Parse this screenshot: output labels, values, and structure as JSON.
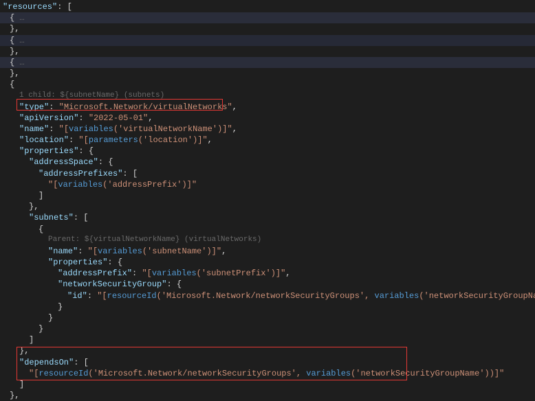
{
  "code": {
    "resourcesKey": "\"resources\"",
    "colon": ": ",
    "openBracket": "[",
    "closeBracket": "]",
    "openBrace": "{",
    "closeBrace": "}",
    "ellipsis": "…",
    "comma": ",",
    "hint1": "1 child: ${subnetName} (subnets)",
    "typeKey": "\"type\"",
    "typeValue": "\"Microsoft.Network/virtualNetworks\"",
    "apiVersionKey": "\"apiVersion\"",
    "apiVersionValue": "\"2022-05-01\"",
    "nameKey": "\"name\"",
    "nameValue1": "\"[",
    "nameFunc": "variables",
    "nameArg": "'virtualNetworkName'",
    "nameValue2": ")]\"",
    "locationKey": "\"location\"",
    "locationValue1": "\"[",
    "locationFunc": "parameters",
    "locationArg": "'location'",
    "locationValue2": ")]\"",
    "propertiesKey": "\"properties\"",
    "addressSpaceKey": "\"addressSpace\"",
    "addressPrefixesKey": "\"addressPrefixes\"",
    "addressPrefixValue1": "\"[",
    "addressPrefixFunc": "variables",
    "addressPrefixArg": "'addressPrefix'",
    "addressPrefixValue2": ")]\"",
    "subnetsKey": "\"subnets\"",
    "hint2": "Parent: ${virtualNetworkName} (virtualNetworks)",
    "subnetNameKey": "\"name\"",
    "subnetNameValue1": "\"[",
    "subnetNameFunc": "variables",
    "subnetNameArg": "'subnetName'",
    "subnetNameValue2": ")]\"",
    "subnetPropertiesKey": "\"properties\"",
    "subnetAddressPrefixKey": "\"addressPrefix\"",
    "subnetAddressPrefixValue1": "\"[",
    "subnetAddressPrefixFunc": "variables",
    "subnetAddressPrefixArg": "'subnetPrefix'",
    "subnetAddressPrefixValue2": ")]\"",
    "nsgKey": "\"networkSecurityGroup\"",
    "idKey": "\"id\"",
    "idValue1": "\"[",
    "idFunc1": "resourceId",
    "idArg1": "'Microsoft.Network/networkSecurityGroups'",
    "idSep": ", ",
    "idFunc2": "variables",
    "idArg2": "'networkSecurityGroupName'",
    "idValue2": "))]\"",
    "dependsOnKey": "\"dependsOn\"",
    "dependsValue1": "\"[",
    "dependsFunc1": "resourceId",
    "dependsArg1": "'Microsoft.Network/networkSecurityGroups'",
    "dependsSep": ", ",
    "dependsFunc2": "variables",
    "dependsArg2": "'networkSecurityGroupName'",
    "dependsValue2": "))]\""
  }
}
